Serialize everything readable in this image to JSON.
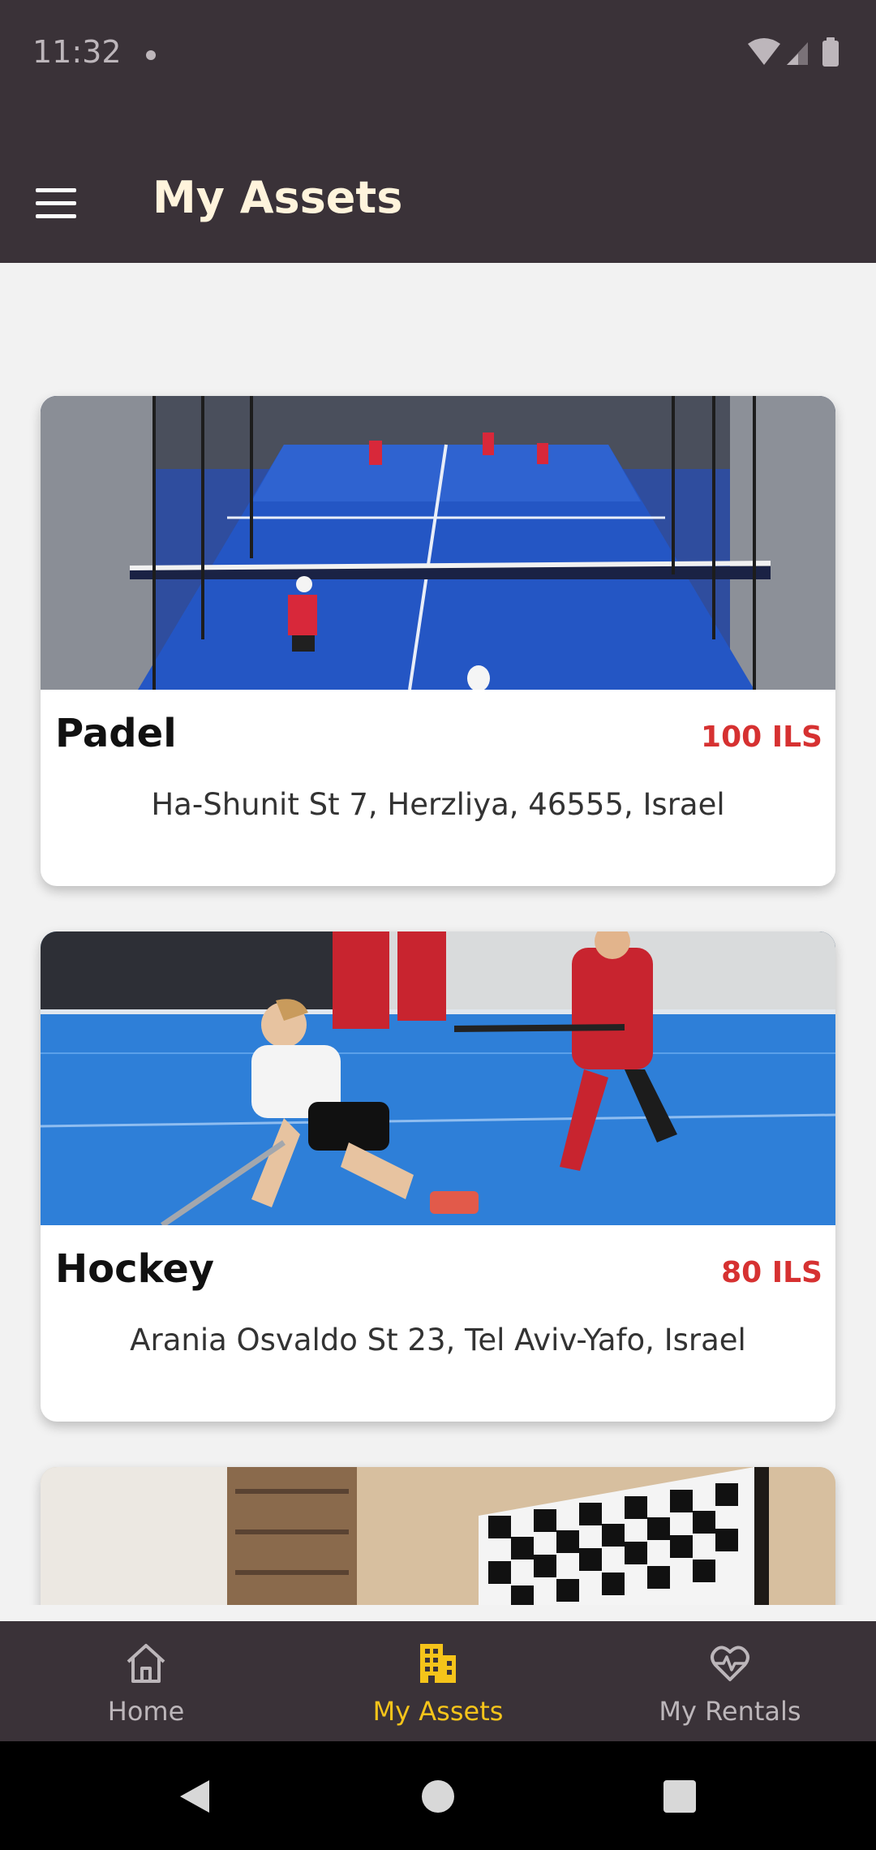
{
  "status_bar": {
    "time": "11:32"
  },
  "app_bar": {
    "title": "My Assets",
    "menu_icon": "menu-icon"
  },
  "assets": [
    {
      "name": "Padel",
      "price": "100 ILS",
      "address": "Ha-Shunit St 7, Herzliya, 46555, Israel",
      "image": "padel-court-photo"
    },
    {
      "name": "Hockey",
      "price": "80 ILS",
      "address": "Arania Osvaldo St 23, Tel Aviv-Yafo, Israel",
      "image": "field-hockey-photo"
    },
    {
      "name": "",
      "price": "",
      "address": "",
      "image": "chess-room-photo"
    }
  ],
  "bottom_nav": {
    "items": [
      {
        "label": "Home",
        "icon": "home-icon",
        "active": false
      },
      {
        "label": "My Assets",
        "icon": "building-icon",
        "active": true
      },
      {
        "label": "My Rentals",
        "icon": "heart-pulse-icon",
        "active": false
      }
    ]
  },
  "colors": {
    "bar_bg": "#3a3238",
    "title": "#fff4dc",
    "price": "#d63131",
    "nav_active": "#f5c41a",
    "nav_inactive": "#bcb6ba"
  }
}
